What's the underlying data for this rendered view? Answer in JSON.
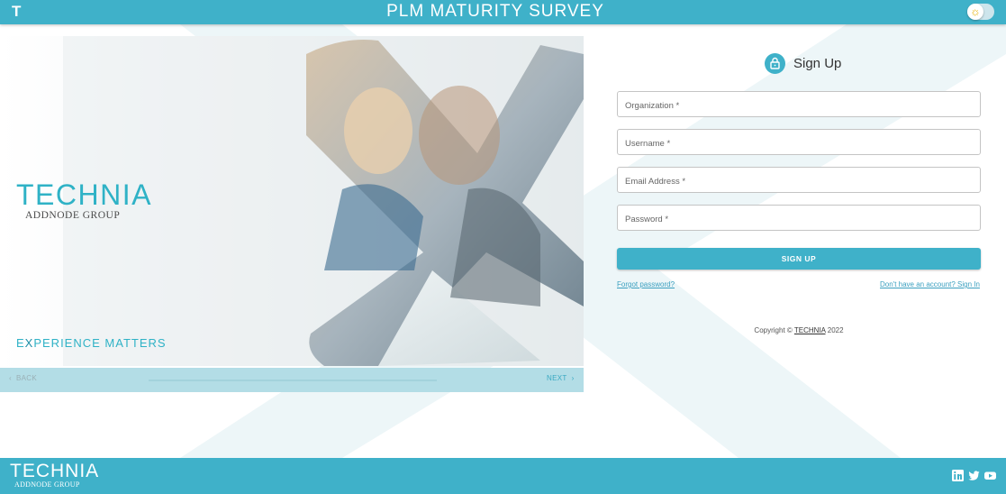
{
  "header": {
    "logo_letter": "T",
    "title": "PLM MATURITY SURVEY",
    "theme_icon": "sun-icon"
  },
  "hero": {
    "brand": "TECHNIA",
    "group": "ADDNODE GROUP",
    "tagline_pre": "E",
    "tagline_x": "X",
    "tagline_post": "PERIENCE MATTERS"
  },
  "stepper": {
    "back_label": "BACK",
    "next_label": "NEXT"
  },
  "signup": {
    "title": "Sign Up",
    "fields": [
      {
        "label": "Organization *"
      },
      {
        "label": "Username *"
      },
      {
        "label": "Email Address *"
      },
      {
        "label": "Password *"
      }
    ],
    "button_label": "SIGN UP",
    "forgot_link": "Forgot password?",
    "signin_link": "Don't have an account? Sign In",
    "copyright_prefix": "Copyright © ",
    "copyright_brand": "TECHNIA",
    "copyright_year": " 2022"
  },
  "footer": {
    "logo": "TECHNIA",
    "sub": "ADDNODE GROUP",
    "social": [
      "linkedin-icon",
      "twitter-icon",
      "youtube-icon"
    ]
  },
  "colors": {
    "accent": "#3fb1c9",
    "brand_text": "#2fb2c6"
  }
}
